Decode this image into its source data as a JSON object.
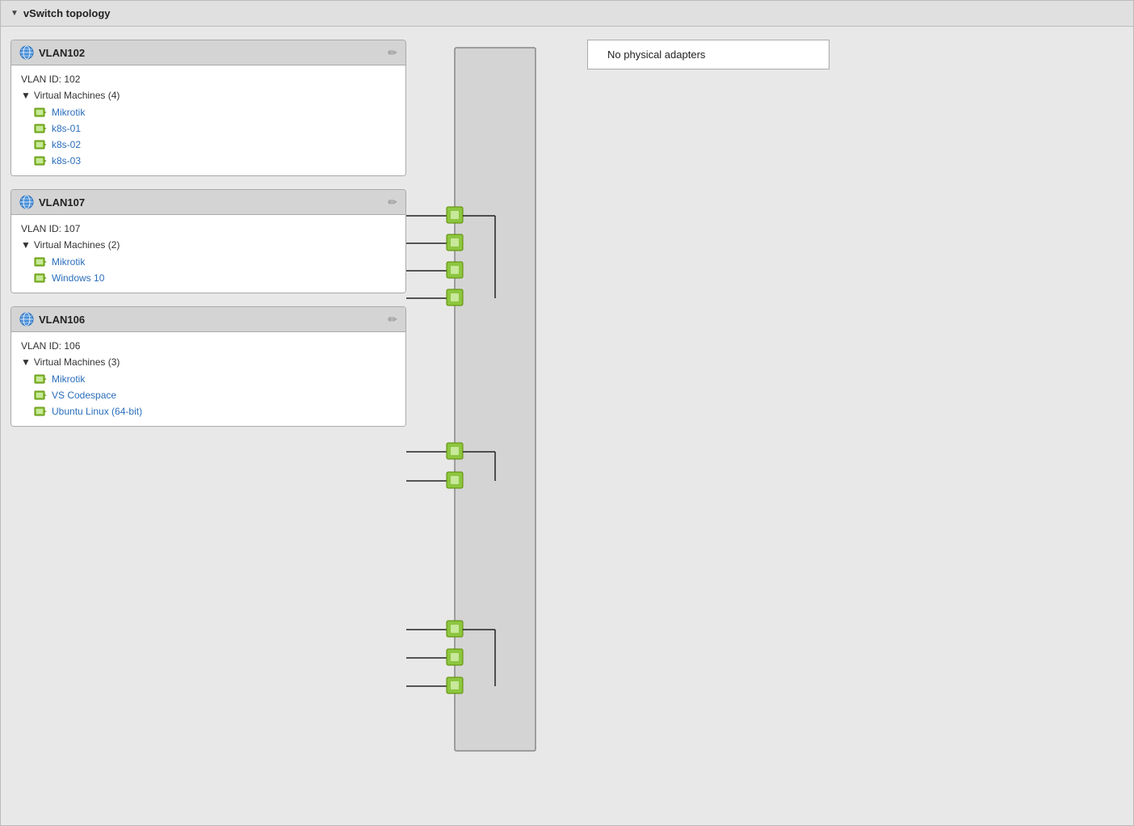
{
  "panel": {
    "title": "vSwitch topology",
    "collapse_icon": "▼"
  },
  "physical_adapters": {
    "label": "No physical adapters"
  },
  "vlans": [
    {
      "id": "vlan102",
      "name": "VLAN102",
      "vlan_id_label": "VLAN ID: 102",
      "vm_section_label": "Virtual Machines (4)",
      "vm_count": 4,
      "vms": [
        {
          "name": "Mikrotik"
        },
        {
          "name": "k8s-01"
        },
        {
          "name": "k8s-02"
        },
        {
          "name": "k8s-03"
        }
      ]
    },
    {
      "id": "vlan107",
      "name": "VLAN107",
      "vlan_id_label": "VLAN ID: 107",
      "vm_section_label": "Virtual Machines (2)",
      "vm_count": 2,
      "vms": [
        {
          "name": "Mikrotik"
        },
        {
          "name": "Windows 10"
        }
      ]
    },
    {
      "id": "vlan106",
      "name": "VLAN106",
      "vlan_id_label": "VLAN ID: 106",
      "vm_section_label": "Virtual Machines (3)",
      "vm_count": 3,
      "vms": [
        {
          "name": "Mikrotik"
        },
        {
          "name": "VS Codespace"
        },
        {
          "name": "Ubuntu Linux (64-bit)"
        }
      ]
    }
  ],
  "icons": {
    "pencil": "✏",
    "triangle_down": "▼",
    "triangle_right": "▶"
  }
}
